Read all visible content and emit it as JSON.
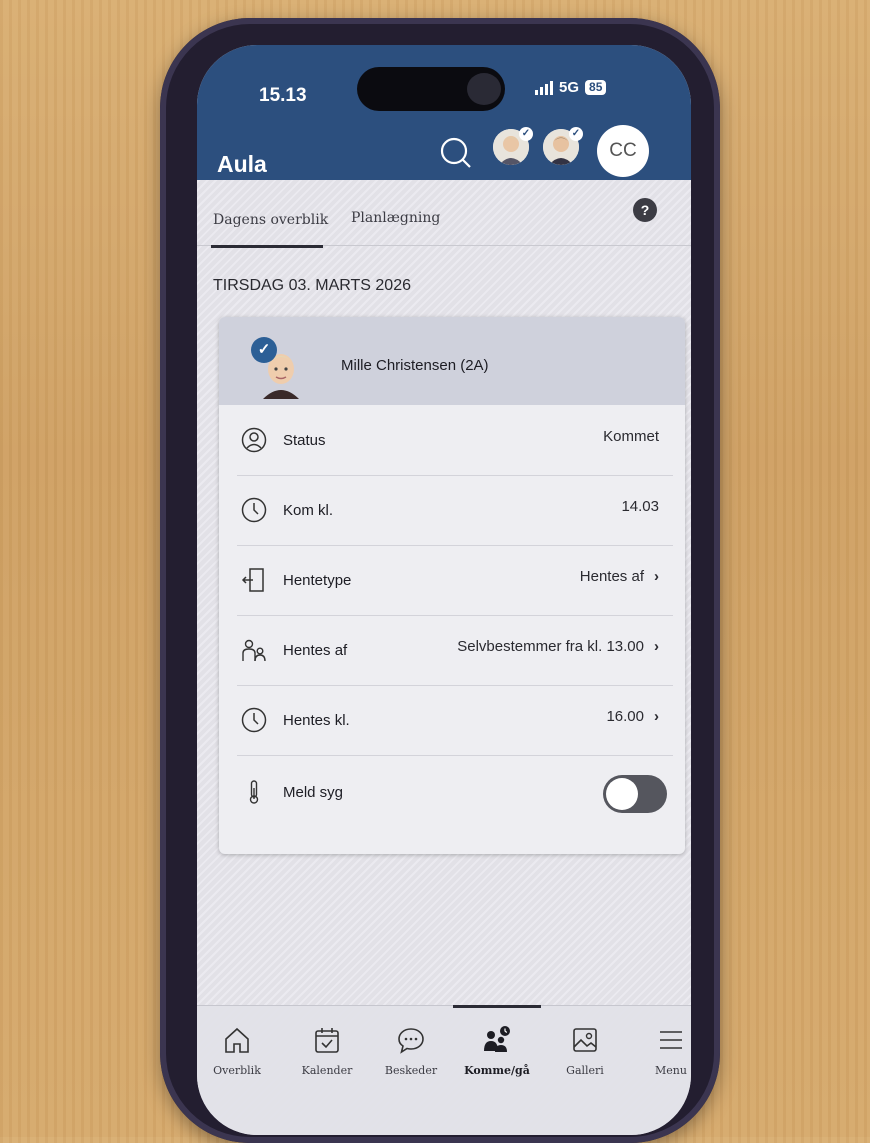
{
  "status_bar": {
    "time": "15.13",
    "network": "5G",
    "battery": "85"
  },
  "header": {
    "app_title": "Aula",
    "profile_initials": "CC"
  },
  "tabs": [
    {
      "label": "Dagens overblik",
      "active": true
    },
    {
      "label": "Planlægning",
      "active": false
    }
  ],
  "help_label": "?",
  "date_heading": "TIRSDAG 03. MARTS 2026",
  "child": {
    "name": "Mille Christensen (2A)",
    "checked": "✓"
  },
  "rows": [
    {
      "label": "Status",
      "value": "Kommet",
      "icon": "person-circle-icon"
    },
    {
      "label": "Kom kl.",
      "value": "14.03",
      "icon": "clock-icon"
    },
    {
      "label": "Hentetype",
      "value": "Hentes af",
      "icon": "door-exit-icon"
    },
    {
      "label": "Hentes af",
      "value": "Selvbestemmer fra kl. 13.00",
      "icon": "people-icon"
    },
    {
      "label": "Hentes kl.",
      "value": "16.00",
      "icon": "clock-icon"
    },
    {
      "label": "Meld syg",
      "toggle_on": false,
      "icon": "thermometer-icon"
    }
  ],
  "chevron": "›",
  "bottom_nav": [
    {
      "label": "Overblik",
      "icon": "home-icon",
      "active": false
    },
    {
      "label": "Kalender",
      "icon": "calendar-icon",
      "active": false
    },
    {
      "label": "Beskeder",
      "icon": "chat-bubble-icon",
      "active": false
    },
    {
      "label": "Komme/gå",
      "icon": "people-clock-icon",
      "active": true
    },
    {
      "label": "Galleri",
      "icon": "image-icon",
      "active": false
    },
    {
      "label": "Menu",
      "icon": "menu-icon",
      "active": false
    }
  ],
  "colors": {
    "header_bg": "#2c4f7e",
    "accent": "#2c5f96",
    "toggle_off": "#55565e"
  }
}
